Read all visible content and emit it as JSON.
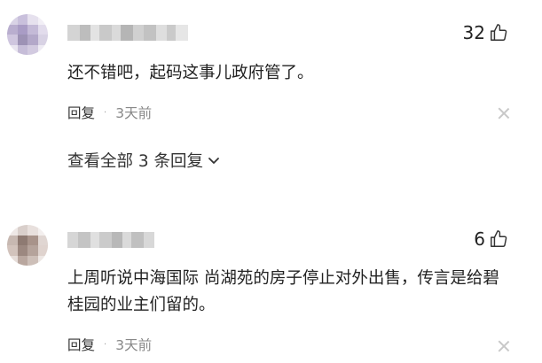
{
  "comments": [
    {
      "likes": "32",
      "text": "还不错吧，起码这事儿政府管了。",
      "reply_label": "回复",
      "separator": "·",
      "time": "3天前",
      "view_replies": "查看全部 3 条回复"
    },
    {
      "likes": "6",
      "text": "上周听说中海国际 尚湖苑的房子停止对外出售，传言是给碧桂园的业主们留的。",
      "reply_label": "回复",
      "separator": "·",
      "time": "3天前"
    }
  ],
  "icons": {
    "like": "thumbs-up-icon",
    "close": "close-icon",
    "expand": "chevron-down-icon"
  },
  "colors": {
    "text": "#222222",
    "meta": "#888888",
    "close": "#c8c8c8"
  }
}
